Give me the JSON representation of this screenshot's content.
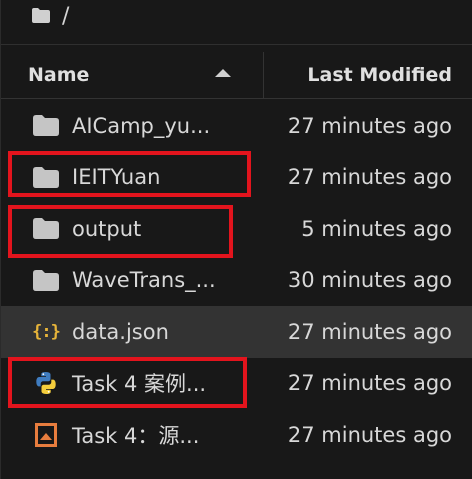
{
  "breadcrumb": {
    "folder_icon": "folder-icon",
    "path": "/"
  },
  "header": {
    "name_label": "Name",
    "last_modified_label": "Last Modified",
    "sort_icon": "sort-ascending-icon"
  },
  "files": [
    {
      "icon": "folder-icon",
      "name": "AICamp_yu...",
      "modified": "27 minutes ago"
    },
    {
      "icon": "folder-icon",
      "name": "IEITYuan",
      "modified": "27 minutes ago"
    },
    {
      "icon": "folder-icon",
      "name": "output",
      "modified": "5 minutes ago"
    },
    {
      "icon": "folder-icon",
      "name": "WaveTrans_...",
      "modified": "30 minutes ago"
    },
    {
      "icon": "json-file-icon",
      "name": "data.json",
      "modified": "27 minutes ago"
    },
    {
      "icon": "python-file-icon",
      "name": "Task 4 案例...",
      "modified": "27 minutes ago"
    },
    {
      "icon": "slides-file-icon",
      "name": "Task 4：源...",
      "modified": "27 minutes ago"
    }
  ],
  "colors": {
    "background": "#181818",
    "selected_row": "#333333",
    "highlight_box": "#e3141d",
    "json_icon": "#e8b53a",
    "slides_icon": "#e87d3e"
  }
}
